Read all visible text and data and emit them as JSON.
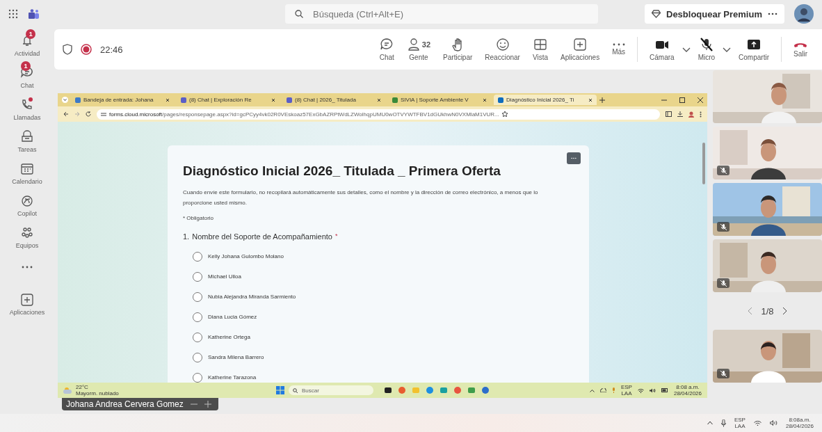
{
  "top_bar": {
    "search": {
      "placeholder": "Búsqueda (Ctrl+Alt+E)"
    },
    "premium_button": "Desbloquear Premium"
  },
  "sidebar": {
    "items": [
      {
        "label": "Actividad",
        "badge": "1",
        "dot": false
      },
      {
        "label": "Chat",
        "badge": "1",
        "dot": false
      },
      {
        "label": "Llamadas",
        "dot": true
      },
      {
        "label": "Tareas",
        "dot": false
      },
      {
        "label": "Calendario",
        "dot": false
      },
      {
        "label": "Copilot",
        "dot": false
      },
      {
        "label": "Equipos",
        "dot": false
      },
      {
        "kind": "more",
        "dot": false
      },
      {
        "label": "Aplicaciones",
        "dot": false
      }
    ]
  },
  "meeting_toolbar": {
    "recording": true,
    "timer": "22:46",
    "actions": [
      {
        "label": "Chat"
      },
      {
        "label": "Gente",
        "count": "32"
      },
      {
        "label": "Participar"
      },
      {
        "label": "Reaccionar"
      },
      {
        "label": "Vista"
      },
      {
        "label": "Aplicaciones"
      },
      {
        "label": "Más"
      }
    ],
    "devices": [
      {
        "label": "Cámara",
        "caret": true,
        "muted": false
      },
      {
        "label": "Micro",
        "caret": true,
        "muted": true
      },
      {
        "label": "Compartir",
        "caret": false,
        "muted": false
      },
      {
        "label": "Salir",
        "caret": false,
        "muted": false
      }
    ]
  },
  "shared_screen": {
    "browser": {
      "tabs": [
        {
          "title": "Bandeja de entrada: Johana",
          "selected": false
        },
        {
          "title": "(8) Chat | Exploración Re",
          "selected": false
        },
        {
          "title": "(8) Chat | 2026_ Titulada",
          "selected": false
        },
        {
          "title": "SIVIA | Soporte Ambiente V",
          "selected": false
        },
        {
          "title": "Diagnóstico Inicial 2026_ Ti",
          "selected": true
        }
      ],
      "url_host": "forms.cloud.microsoft",
      "url_path": "/pages/responsepage.aspx?id=gcPCyy4vk02R0VEskoaz57ExGbAZRPtWdLZWolhqpUMU0wOTVYWTFBV1dGUkhwN0VXMlaM1VUR..."
    },
    "form": {
      "title": "Diagnóstico Inicial 2026_ Titulada _ Primera Oferta",
      "notice": "Cuando envíe este formulario, no recopilará automáticamente sus detalles, como el nombre y la dirección de correo electrónico, a menos que lo proporcione usted mismo.",
      "required_note": "* Obligatorio",
      "question": {
        "number": "1.",
        "text": "Nombre del Soporte de Acompañamiento",
        "required_mark": "*",
        "options": [
          {
            "label": "Kelly Johana Gulombo Molano",
            "selected": false
          },
          {
            "label": "Michael Ulloa",
            "selected": false
          },
          {
            "label": "Nubia Alejandra Miranda Sarmiento",
            "selected": false
          },
          {
            "label": "Diana Lucia Gómez",
            "selected": false
          },
          {
            "label": "Katherine Ortega",
            "selected": false
          },
          {
            "label": "Sandra Milena Barrero",
            "selected": false
          },
          {
            "label": "Katherine Tarazona",
            "selected": false
          }
        ]
      }
    },
    "taskbar": {
      "weather_temp": "22°C",
      "weather_text": "Mayorm. nublado",
      "search_placeholder": "Buscar",
      "lang": "ESP",
      "layout": "LAA",
      "time": "8:08 a.m.",
      "date": "28/04/2026"
    },
    "presenter_name": "Johana Andrea Cervera Gomez"
  },
  "participants": {
    "tiles": [
      {
        "kind": "picture",
        "muted": false
      },
      {
        "kind": "picture",
        "muted": true
      },
      {
        "kind": "picture",
        "muted": true
      },
      {
        "kind": "picture",
        "muted": true
      },
      {
        "kind": "picture",
        "muted": true
      }
    ],
    "pager": "1/8"
  },
  "system_tray": {
    "lang": "ESP",
    "layout": "LAA",
    "time": "8:08a.m.",
    "date": "28/04/2026"
  }
}
